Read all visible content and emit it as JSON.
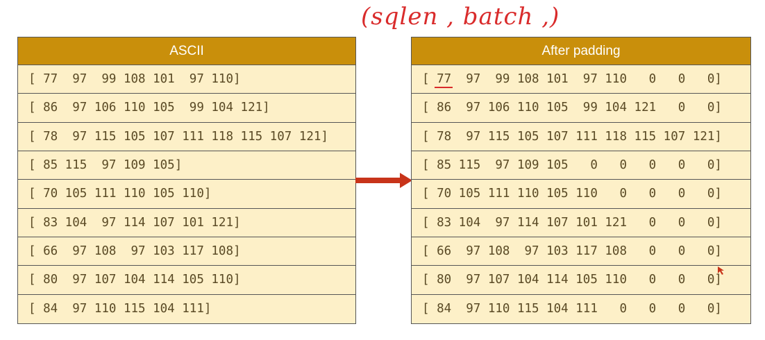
{
  "annotation": "(sqlen , batch ,)",
  "left_table": {
    "header": "ASCII",
    "rows": [
      "[ 77  97  99 108 101  97 110]",
      "[ 86  97 106 110 105  99 104 121]",
      "[ 78  97 115 105 107 111 118 115 107 121]",
      "[ 85 115  97 109 105]",
      "[ 70 105 111 110 105 110]",
      "[ 83 104  97 114 107 101 121]",
      "[ 66  97 108  97 103 117 108]",
      "[ 80  97 107 104 114 105 110]",
      "[ 84  97 110 115 104 111]"
    ]
  },
  "right_table": {
    "header": "After padding",
    "rows": [
      "[ 77  97  99 108 101  97 110   0   0   0]",
      "[ 86  97 106 110 105  99 104 121   0   0]",
      "[ 78  97 115 105 107 111 118 115 107 121]",
      "[ 85 115  97 109 105   0   0   0   0   0]",
      "[ 70 105 111 110 105 110   0   0   0   0]",
      "[ 83 104  97 114 107 101 121   0   0   0]",
      "[ 66  97 108  97 103 117 108   0   0   0]",
      "[ 80  97 107 104 114 105 110   0   0   0]",
      "[ 84  97 110 115 104 111   0   0   0   0]"
    ]
  },
  "colors": {
    "header_bg": "#c98f0b",
    "cell_bg": "#fdf0c8",
    "arrow": "#c8341a",
    "annotation": "#d92b2b"
  }
}
